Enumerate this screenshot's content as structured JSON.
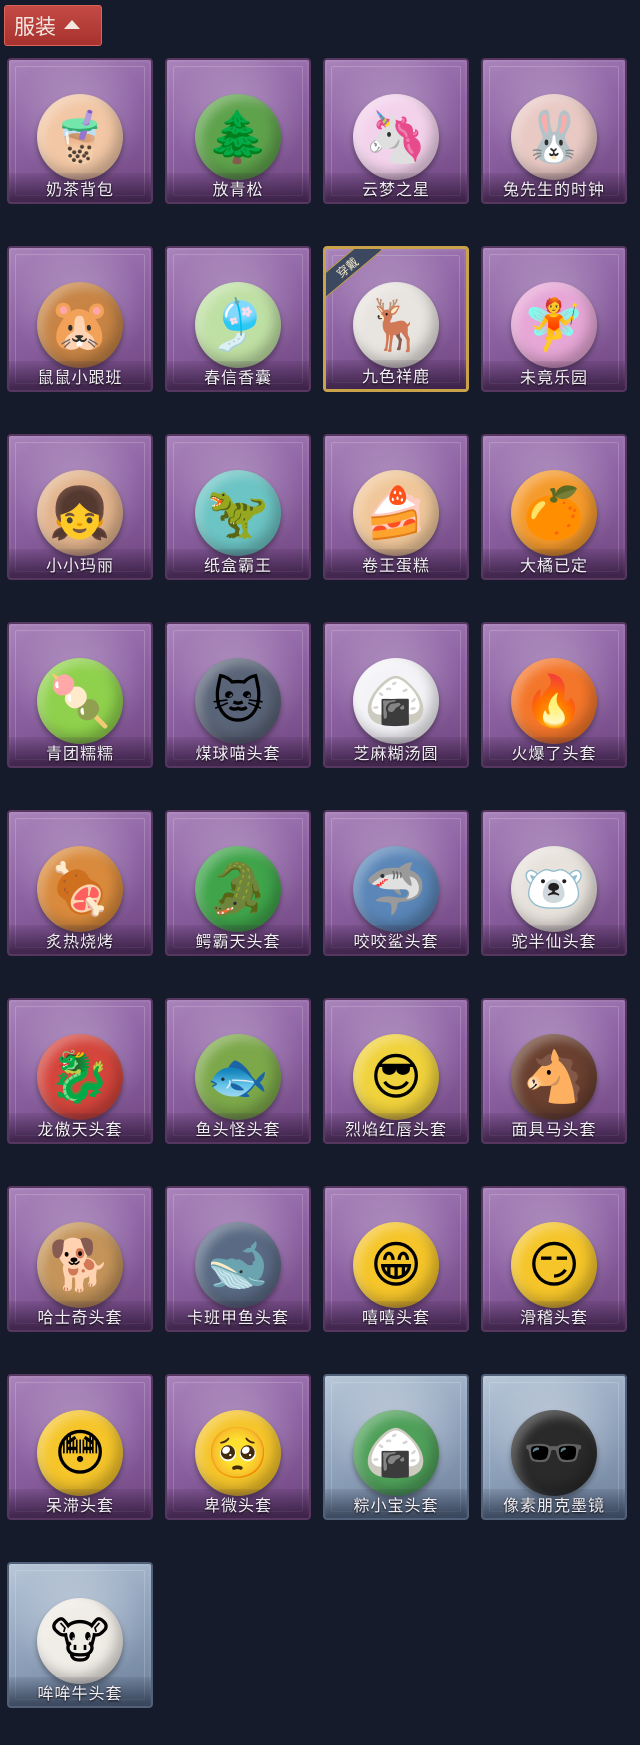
{
  "header": {
    "tab_label": "服装",
    "tab_icon": "chevron-up-icon"
  },
  "equipped_label": "穿戴",
  "items": [
    {
      "label": "奶茶背包",
      "icon": "milk-tea-bag-icon",
      "glyph": "🧋",
      "color": "#f2c7a5",
      "theme": "purple"
    },
    {
      "label": "放青松",
      "icon": "pine-bonsai-icon",
      "glyph": "🌲",
      "color": "#5fa24c",
      "theme": "purple"
    },
    {
      "label": "云梦之星",
      "icon": "unicorn-cloud-icon",
      "glyph": "🦄",
      "color": "#f3d2ec",
      "theme": "purple"
    },
    {
      "label": "兔先生的时钟",
      "icon": "rabbit-clock-icon",
      "glyph": "🐰",
      "color": "#e9c9c4",
      "theme": "purple"
    },
    {
      "label": "鼠鼠小跟班",
      "icon": "hamster-icon",
      "glyph": "🐹",
      "color": "#c78445",
      "theme": "purple"
    },
    {
      "label": "春信香囊",
      "icon": "sachet-icon",
      "glyph": "🎐",
      "color": "#bfe0a4",
      "theme": "purple"
    },
    {
      "label": "九色祥鹿",
      "icon": "deer-icon",
      "glyph": "🦌",
      "color": "#e8e4e0",
      "theme": "purple",
      "equipped": true
    },
    {
      "label": "未竟乐园",
      "icon": "doll-girl-icon",
      "glyph": "🧚",
      "color": "#e6a6d6",
      "theme": "purple"
    },
    {
      "label": "小小玛丽",
      "icon": "mary-doll-icon",
      "glyph": "👧",
      "color": "#e2b38c",
      "theme": "purple"
    },
    {
      "label": "纸盒霸王",
      "icon": "cardboard-dino-icon",
      "glyph": "🦖",
      "color": "#6cc4c4",
      "theme": "purple"
    },
    {
      "label": "卷王蛋糕",
      "icon": "roll-cake-icon",
      "glyph": "🍰",
      "color": "#f0c79a",
      "theme": "purple"
    },
    {
      "label": "大橘已定",
      "icon": "orange-slice-icon",
      "glyph": "🍊",
      "color": "#f59a2c",
      "theme": "purple"
    },
    {
      "label": "青团糯糯",
      "icon": "green-dumpling-icon",
      "glyph": "🍡",
      "color": "#8fd14c",
      "theme": "purple"
    },
    {
      "label": "煤球喵头套",
      "icon": "cat-head-icon",
      "glyph": "🐱",
      "color": "#5a6478",
      "theme": "purple"
    },
    {
      "label": "芝麻糊汤圆",
      "icon": "rice-ball-icon",
      "glyph": "🍙",
      "color": "#f4f4f8",
      "theme": "purple"
    },
    {
      "label": "火爆了头套",
      "icon": "fire-head-icon",
      "glyph": "🔥",
      "color": "#f4762a",
      "theme": "purple"
    },
    {
      "label": "炙热烧烤",
      "icon": "bbq-meat-icon",
      "glyph": "🍖",
      "color": "#d98a3c",
      "theme": "purple"
    },
    {
      "label": "鳄霸天头套",
      "icon": "crocodile-head-icon",
      "glyph": "🐊",
      "color": "#3fa44a",
      "theme": "purple"
    },
    {
      "label": "咬咬鲨头套",
      "icon": "shark-head-icon",
      "glyph": "🦈",
      "color": "#5a86b8",
      "theme": "purple"
    },
    {
      "label": "驼半仙头套",
      "icon": "alpaca-head-icon",
      "glyph": "🐻‍❄️",
      "color": "#e8e2dc",
      "theme": "purple"
    },
    {
      "label": "龙傲天头套",
      "icon": "dragon-head-icon",
      "glyph": "🐉",
      "color": "#d4453c",
      "theme": "purple"
    },
    {
      "label": "鱼头怪头套",
      "icon": "fish-head-icon",
      "glyph": "🐟",
      "color": "#7ca84a",
      "theme": "purple"
    },
    {
      "label": "烈焰红唇头套",
      "icon": "pikachu-head-icon",
      "glyph": "😎",
      "color": "#f0d23c",
      "theme": "purple"
    },
    {
      "label": "面具马头套",
      "icon": "horse-head-icon",
      "glyph": "🐴",
      "color": "#6a4030",
      "theme": "purple"
    },
    {
      "label": "哈士奇头套",
      "icon": "husky-head-icon",
      "glyph": "🐕",
      "color": "#c4945a",
      "theme": "purple"
    },
    {
      "label": "卡班甲鱼头套",
      "icon": "whale-head-icon",
      "glyph": "🐋",
      "color": "#5a6a84",
      "theme": "purple"
    },
    {
      "label": "嘻嘻头套",
      "icon": "grin-emoji-icon",
      "glyph": "😁",
      "color": "#f5c52a",
      "theme": "purple"
    },
    {
      "label": "滑稽头套",
      "icon": "smirk-emoji-icon",
      "glyph": "😏",
      "color": "#f5c52a",
      "theme": "purple"
    },
    {
      "label": "呆滞头套",
      "icon": "stunned-emoji-icon",
      "glyph": "😳",
      "color": "#f5c52a",
      "theme": "purple"
    },
    {
      "label": "卑微头套",
      "icon": "humble-emoji-icon",
      "glyph": "🥺",
      "color": "#f5c52a",
      "theme": "purple"
    },
    {
      "label": "粽小宝头套",
      "icon": "zongzi-head-icon",
      "glyph": "🍙",
      "color": "#4fa05a",
      "theme": "blue"
    },
    {
      "label": "像素朋克墨镜",
      "icon": "pixel-sunglasses-icon",
      "glyph": "🕶️",
      "color": "#2a2a2a",
      "theme": "blue"
    },
    {
      "label": "哞哞牛头套",
      "icon": "cow-head-icon",
      "glyph": "🐮",
      "color": "#f0ece6",
      "theme": "blue"
    }
  ]
}
